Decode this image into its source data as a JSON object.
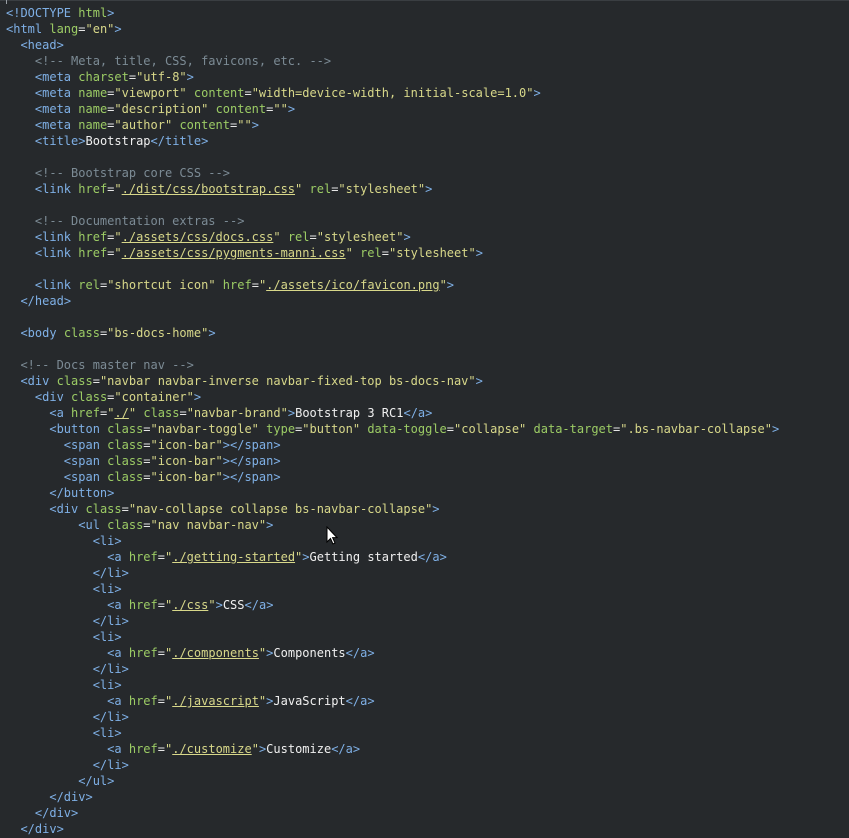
{
  "editor": {
    "language": "html",
    "lines": [
      "<!DOCTYPE html>",
      "<html lang=\"en\">",
      "  <head>",
      "    <!-- Meta, title, CSS, favicons, etc. -->",
      "    <meta charset=\"utf-8\">",
      "    <meta name=\"viewport\" content=\"width=device-width, initial-scale=1.0\">",
      "    <meta name=\"description\" content=\"\">",
      "    <meta name=\"author\" content=\"\">",
      "    <title>Bootstrap</title>",
      "",
      "    <!-- Bootstrap core CSS -->",
      "    <link href=\"./dist/css/bootstrap.css\" rel=\"stylesheet\">",
      "",
      "    <!-- Documentation extras -->",
      "    <link href=\"./assets/css/docs.css\" rel=\"stylesheet\">",
      "    <link href=\"./assets/css/pygments-manni.css\" rel=\"stylesheet\">",
      "",
      "    <link rel=\"shortcut icon\" href=\"./assets/ico/favicon.png\">",
      "  </head>",
      "",
      "  <body class=\"bs-docs-home\">",
      "",
      "  <!-- Docs master nav -->",
      "  <div class=\"navbar navbar-inverse navbar-fixed-top bs-docs-nav\">",
      "    <div class=\"container\">",
      "      <a href=\"./\" class=\"navbar-brand\">Bootstrap 3 RC1</a>",
      "      <button class=\"navbar-toggle\" type=\"button\" data-toggle=\"collapse\" data-target=\".bs-navbar-collapse\">",
      "        <span class=\"icon-bar\"></span>",
      "        <span class=\"icon-bar\"></span>",
      "        <span class=\"icon-bar\"></span>",
      "      </button>",
      "      <div class=\"nav-collapse collapse bs-navbar-collapse\">",
      "          <ul class=\"nav navbar-nav\">",
      "            <li>",
      "              <a href=\"./getting-started\">Getting started</a>",
      "            </li>",
      "            <li>",
      "              <a href=\"./css\">CSS</a>",
      "            </li>",
      "            <li>",
      "              <a href=\"./components\">Components</a>",
      "            </li>",
      "            <li>",
      "              <a href=\"./javascript\">JavaScript</a>",
      "            </li>",
      "            <li>",
      "              <a href=\"./customize\">Customize</a>",
      "            </li>",
      "          </ul>",
      "      </div>",
      "    </div>",
      "  </div>"
    ]
  },
  "colors": {
    "background": "#26292c",
    "tag": "#7fb0e6",
    "attribute": "#9ccc65",
    "string": "#d8d88a",
    "comment": "#7c8b95",
    "text": "#f0f0f0"
  },
  "pointer": {
    "icon": "mouse-pointer-icon"
  }
}
